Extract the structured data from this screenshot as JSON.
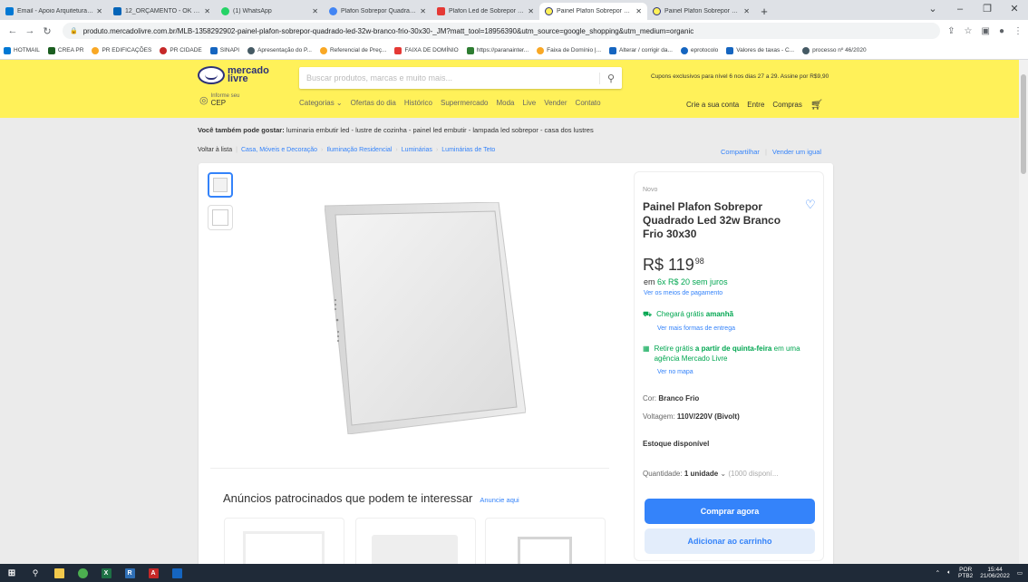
{
  "browser": {
    "tabs": [
      {
        "title": "Email - Apoio Arquitetura em P",
        "color": "#0078d4",
        "active": false
      },
      {
        "title": "12_ORÇAMENTO - OK - OneDri",
        "color": "#0364b8",
        "active": false
      },
      {
        "title": "(1) WhatsApp",
        "color": "#25d366",
        "active": false
      },
      {
        "title": "Plafon Sobrepor Quadrado Led",
        "color": "#4285f4",
        "active": false
      },
      {
        "title": "Plafon Led de Sobrepor Quadr",
        "color": "#e53935",
        "active": false
      },
      {
        "title": "Painel Plafon Sobrepor Quadra",
        "color": "#fff159",
        "active": true
      },
      {
        "title": "Painel Plafon Sobrepor Quadra",
        "color": "#fff159",
        "active": false
      }
    ],
    "new_tab": "+",
    "url": "produto.mercadolivre.com.br/MLB-1358292902-painel-plafon-sobrepor-quadrado-led-32w-branco-frio-30x30-_JM?matt_tool=18956390&utm_source=google_shopping&utm_medium=organic",
    "bookmarks": [
      {
        "label": "HOTMAIL",
        "color": "#0078d4"
      },
      {
        "label": "CREA PR",
        "color": "#1b5e20"
      },
      {
        "label": "PR EDIFICAÇÕES",
        "color": "#f9a825"
      },
      {
        "label": "PR CIDADE",
        "color": "#c62828"
      },
      {
        "label": "SINAPI",
        "color": "#1565c0"
      },
      {
        "label": "Apresentação do P...",
        "color": "#455a64"
      },
      {
        "label": "Referencial de Preç...",
        "color": "#f9a825"
      },
      {
        "label": "FAIXA DE DOMÍNIO",
        "color": "#e53935"
      },
      {
        "label": "https://paranainter...",
        "color": "#2e7d32"
      },
      {
        "label": "Faixa de Domínio |...",
        "color": "#f9a825"
      },
      {
        "label": "Alterar / corrigir da...",
        "color": "#1565c0"
      },
      {
        "label": "eprotocolo",
        "color": "#1565c0"
      },
      {
        "label": "Valores de taxas - C...",
        "color": "#1565c0"
      },
      {
        "label": "processo nº 46/2020",
        "color": "#455a64"
      }
    ]
  },
  "ml_header": {
    "logo_line1": "mercado",
    "logo_line2": "livre",
    "search_placeholder": "Buscar produtos, marcas e muito mais...",
    "promo": "Cupons exclusivos para nível 6 nos dias 27 a 29. Assine por R$9,90",
    "cep_small": "Informe seu",
    "cep_big": "CEP",
    "nav": [
      "Categorias ⌄",
      "Ofertas do dia",
      "Histórico",
      "Supermercado",
      "Moda",
      "Live",
      "Vender",
      "Contato"
    ],
    "user": [
      "Crie a sua conta",
      "Entre",
      "Compras"
    ]
  },
  "page": {
    "suggest_prefix": "Você também pode gostar:",
    "suggest_items": "luminaria embutir led - lustre de cozinha - painel led embutir - lampada led sobrepor - casa dos lustres",
    "back": "Voltar à lista",
    "breadcrumbs": [
      "Casa, Móveis e Decoração",
      "Iluminação Residencial",
      "Luminárias",
      "Luminárias de Teto"
    ],
    "share": "Compartilhar",
    "sell_same": "Vender um igual",
    "sponsored_title": "Anúncios patrocinados que podem te interessar",
    "sponsored_link": "Anuncie aqui"
  },
  "product": {
    "condition": "Novo",
    "title": "Painel Plafon Sobrepor Quadrado Led 32w Branco Frio 30x30",
    "price_main": "R$ 119",
    "price_cents": "98",
    "installments_prefix": "em",
    "installments": "6x R$ 20 sem juros",
    "payment_link": "Ver os meios de pagamento",
    "shipping_prefix": "Chegará grátis",
    "shipping_when": "amanhã",
    "shipping_more": "Ver mais formas de entrega",
    "pickup_prefix": "Retire grátis",
    "pickup_bold": "a partir de quinta-feira",
    "pickup_suffix": "em uma agência Mercado Livre",
    "map_link": "Ver no mapa",
    "color_label": "Cor:",
    "color_value": "Branco Frio",
    "voltage_label": "Voltagem:",
    "voltage_value": "110V/220V (Bivolt)",
    "stock": "Estoque disponível",
    "qty_label": "Quantidade:",
    "qty_value": "1 unidade",
    "qty_available": "(1000 disponí...",
    "buy_now": "Comprar agora",
    "add_cart": "Adicionar ao carrinho"
  },
  "taskbar": {
    "lang1": "POR",
    "lang2": "PTB2",
    "time": "15:44",
    "date": "21/06/2022"
  },
  "colors": {
    "ml_yellow": "#fff159",
    "ml_blue": "#3483fa",
    "ml_green": "#00a650"
  }
}
